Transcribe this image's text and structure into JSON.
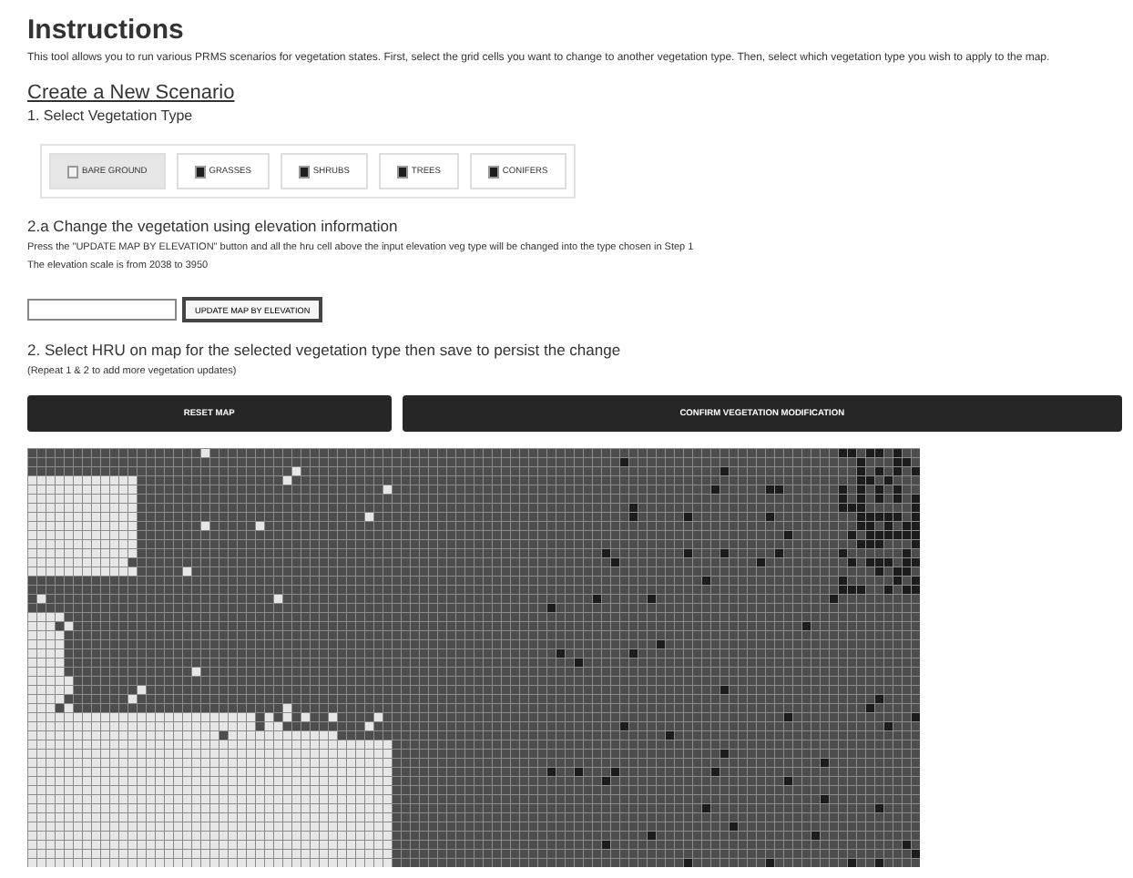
{
  "title": "Instructions",
  "intro": "This tool allows you to run various PRMS scenarios for vegetation states. First, select the grid cells you want to change to another vegetation type. Then, select which vegetation type you wish to apply to the map.",
  "scenario_heading": "Create a New Scenario",
  "step1": "1. Select Vegetation Type",
  "vegetation_types": [
    {
      "label": "BARE GROUND",
      "color": "#f2f2f2",
      "selected": true
    },
    {
      "label": "GRASSES",
      "color": "#1e1e1e",
      "selected": false
    },
    {
      "label": "SHRUBS",
      "color": "#1e1e1e",
      "selected": false
    },
    {
      "label": "TREES",
      "color": "#1e1e1e",
      "selected": false
    },
    {
      "label": "CONIFERS",
      "color": "#1e1e1e",
      "selected": false
    }
  ],
  "step2a": {
    "heading": "2.a Change the vegetation using elevation information",
    "note": "Press the \"UPDATE MAP BY ELEVATION\" button and all the hru cell above the input elevation veg type will be changed into the type chosen in Step 1",
    "scale": "The elevation scale is from 2038 to 3950",
    "button": "UPDATE MAP BY ELEVATION"
  },
  "step2": {
    "heading": "2. Select HRU on map for the selected vegetation type then save to persist the change",
    "note": "(Repeat 1 & 2 to add more vegetation updates)"
  },
  "actions": [
    "RESET MAP",
    "CONFIRM VEGETATION MODIFICATION"
  ]
}
